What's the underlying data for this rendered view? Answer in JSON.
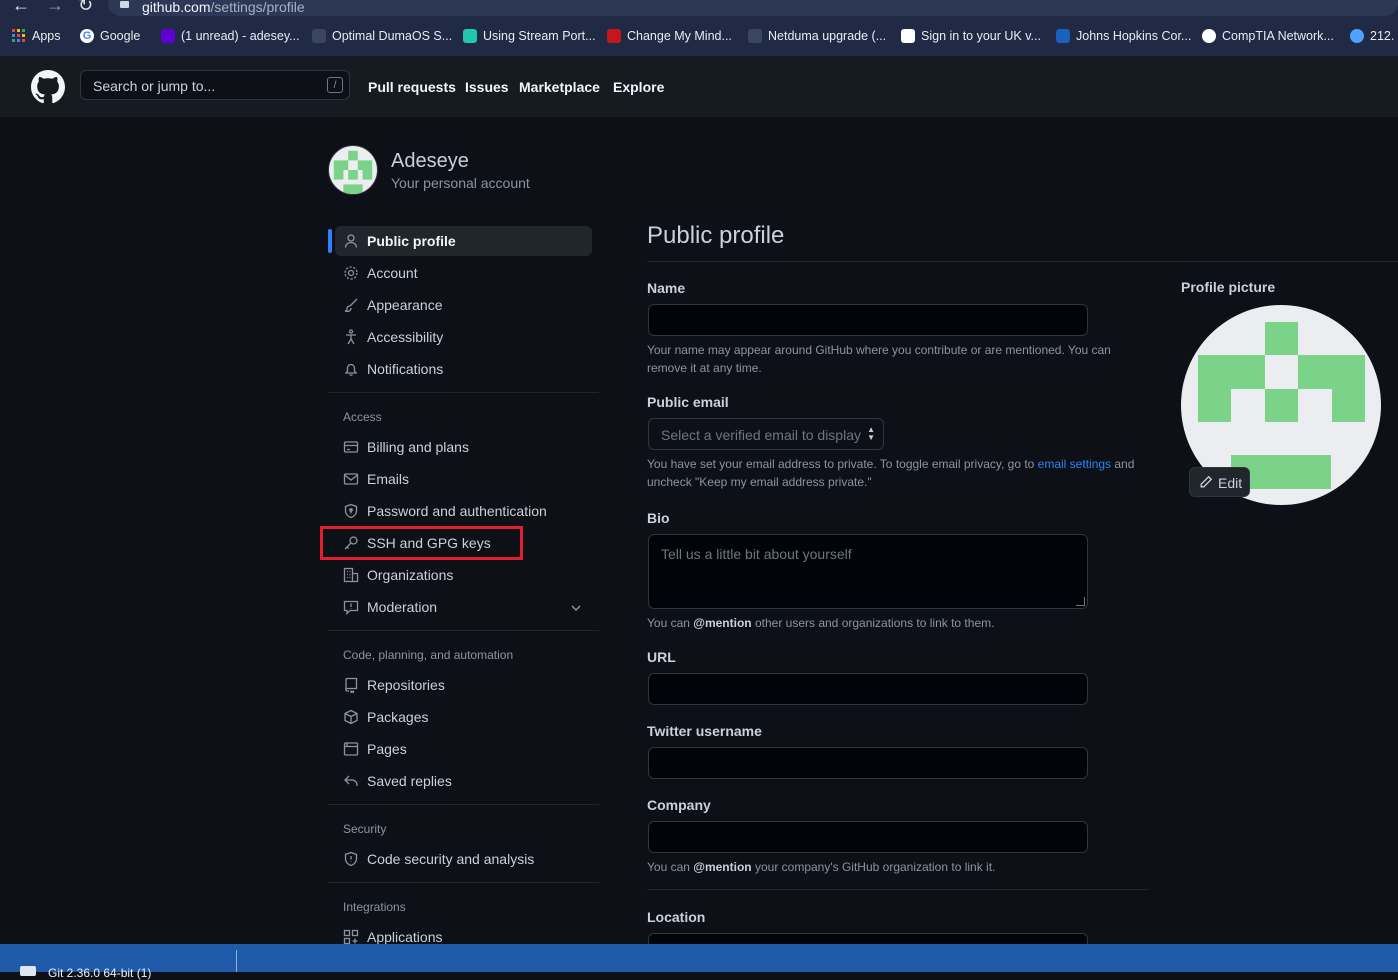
{
  "browser": {
    "url_host": "github.com",
    "url_path": "/settings/profile",
    "bookmarks": [
      {
        "label": "Apps",
        "color": "#4285f4"
      },
      {
        "label": "Google",
        "color": "#ffffff"
      },
      {
        "label": "(1 unread) - adesey...",
        "color": "#6001d2"
      },
      {
        "label": "Optimal DumaOS S...",
        "color": "#3a4560"
      },
      {
        "label": "Using Stream Port...",
        "color": "#21c7a8"
      },
      {
        "label": "Change My Mind...",
        "color": "#c4161c"
      },
      {
        "label": "Netduma upgrade (...",
        "color": "#3a4560"
      },
      {
        "label": "Sign in to your UK v...",
        "color": "#ffffff"
      },
      {
        "label": "Johns Hopkins Cor...",
        "color": "#1b5fbf"
      },
      {
        "label": "CompTIA Network...",
        "color": "#ffffff"
      },
      {
        "label": "212.",
        "color": "#4da3ff"
      }
    ]
  },
  "header": {
    "search_placeholder": "Search or jump to...",
    "search_hint": "/",
    "nav": [
      "Pull requests",
      "Issues",
      "Marketplace",
      "Explore"
    ]
  },
  "user": {
    "name": "Adeseye",
    "subtitle": "Your personal account"
  },
  "sidebar": {
    "group1": [
      {
        "label": "Public profile",
        "icon": "person-icon",
        "selected": true
      },
      {
        "label": "Account",
        "icon": "gear-icon"
      },
      {
        "label": "Appearance",
        "icon": "paintbrush-icon"
      },
      {
        "label": "Accessibility",
        "icon": "accessibility-icon"
      },
      {
        "label": "Notifications",
        "icon": "bell-icon"
      }
    ],
    "access_heading": "Access",
    "access": [
      {
        "label": "Billing and plans",
        "icon": "credit-card-icon"
      },
      {
        "label": "Emails",
        "icon": "mail-icon"
      },
      {
        "label": "Password and authentication",
        "icon": "shield-lock-icon"
      },
      {
        "label": "SSH and GPG keys",
        "icon": "key-icon",
        "highlighted": true
      },
      {
        "label": "Organizations",
        "icon": "organization-icon"
      },
      {
        "label": "Moderation",
        "icon": "report-icon",
        "expandable": true
      }
    ],
    "code_heading": "Code, planning, and automation",
    "code": [
      {
        "label": "Repositories",
        "icon": "repo-icon"
      },
      {
        "label": "Packages",
        "icon": "package-icon"
      },
      {
        "label": "Pages",
        "icon": "browser-icon"
      },
      {
        "label": "Saved replies",
        "icon": "reply-icon"
      }
    ],
    "security_heading": "Security",
    "security": [
      {
        "label": "Code security and analysis",
        "icon": "shield-icon"
      }
    ],
    "integrations_heading": "Integrations",
    "integrations": [
      {
        "label": "Applications",
        "icon": "apps-icon"
      }
    ],
    "highlight_color": "#e0202f"
  },
  "main": {
    "title": "Public profile",
    "name_label": "Name",
    "name_value": "",
    "name_note": "Your name may appear around GitHub where you contribute or are mentioned. You can remove it at any time.",
    "email_label": "Public email",
    "email_select": "Select a verified email to display",
    "email_note_1": "You have set your email address to private. To toggle email privacy, go to ",
    "email_note_link": "email settings",
    "email_note_2": " and uncheck \"Keep my email address private.\"",
    "bio_label": "Bio",
    "bio_placeholder": "Tell us a little bit about yourself",
    "bio_note_1": "You can ",
    "bio_note_mention": "@mention",
    "bio_note_2": " other users and organizations to link to them.",
    "url_label": "URL",
    "url_value": "",
    "twitter_label": "Twitter username",
    "twitter_value": "",
    "company_label": "Company",
    "company_value": "",
    "company_note_1": "You can ",
    "company_note_mention": "@mention",
    "company_note_2": " your company's GitHub organization to link it.",
    "location_label": "Location",
    "profile_picture_label": "Profile picture",
    "edit_label": "Edit",
    "identicon_color": "#7bd389"
  },
  "taskbar": {
    "item": "Git 2.36.0 64-bit (1)"
  }
}
